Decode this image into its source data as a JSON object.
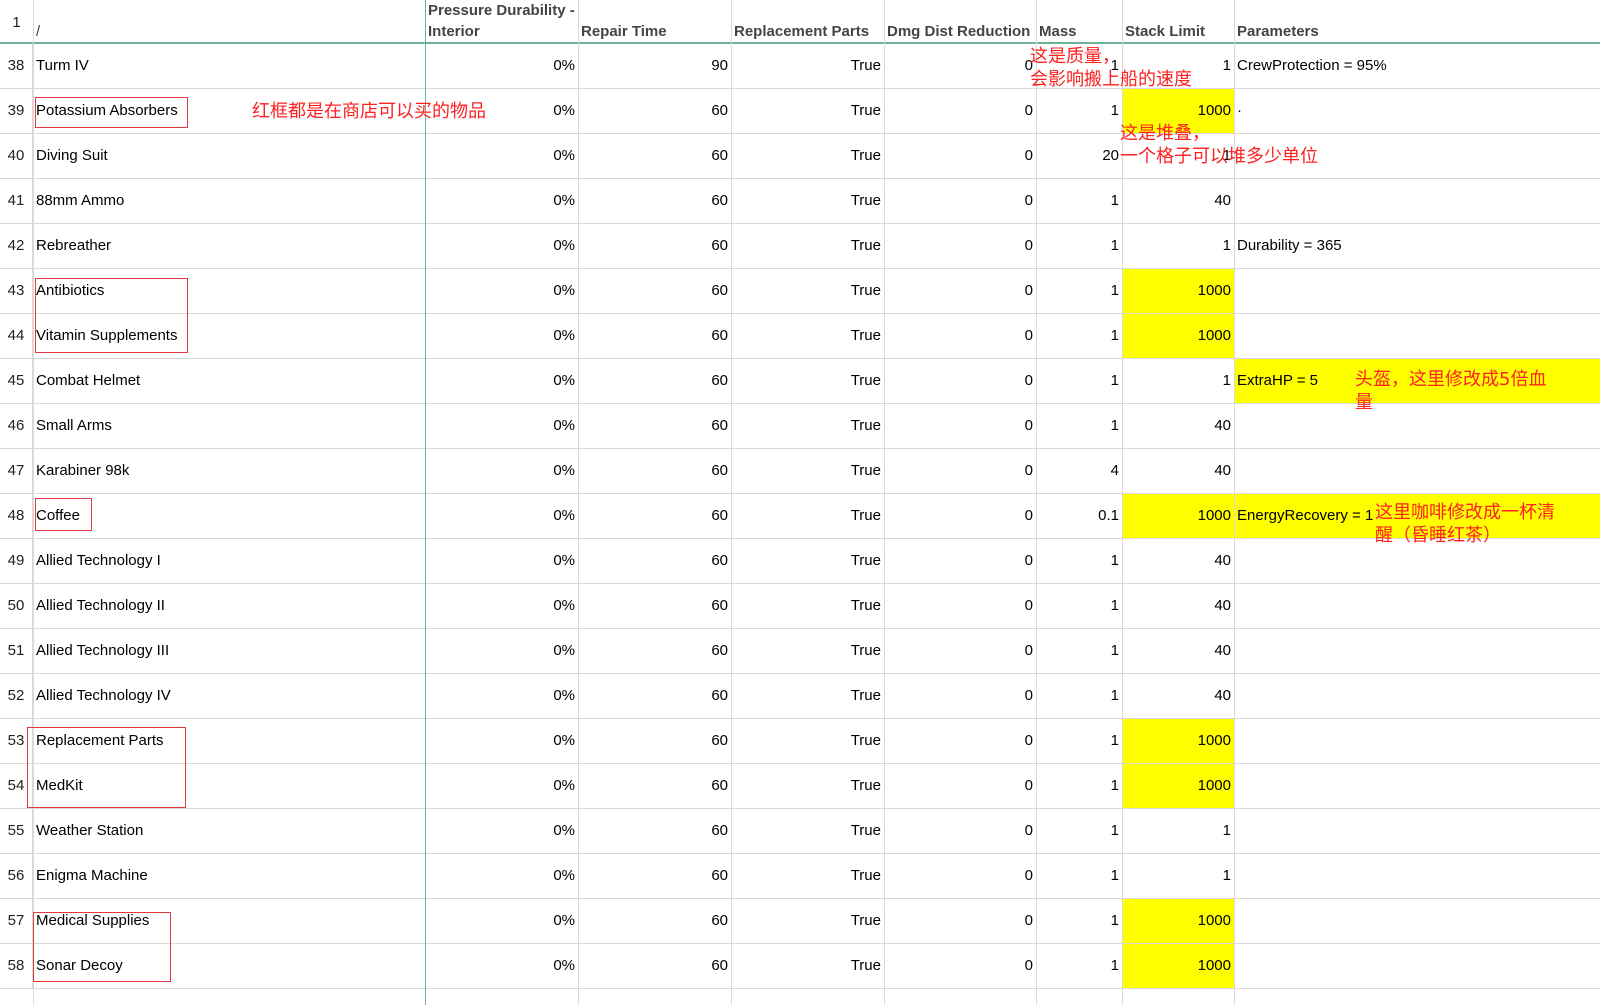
{
  "header": {
    "row_number": "1",
    "name": "/",
    "pressure_durability": "Pressure Durability -\nInterior",
    "pressure_durability_line1": "Pressure Durability -",
    "pressure_durability_line2": "Interior",
    "repair_time": "Repair Time",
    "replacement_parts": "Replacement Parts",
    "dmg_dist_reduction": "Dmg Dist Reduction",
    "mass": "Mass",
    "stack_limit": "Stack Limit",
    "parameters": "Parameters"
  },
  "rows": [
    {
      "num": "38",
      "name": "Turm IV",
      "pressure": "0%",
      "repair": "90",
      "parts": "True",
      "dmg": "0",
      "mass": "1",
      "stack": "1",
      "params": "CrewProtection = 95%",
      "stack_hl": false,
      "params_hl": false
    },
    {
      "num": "39",
      "name": "Potassium Absorbers",
      "pressure": "0%",
      "repair": "60",
      "parts": "True",
      "dmg": "0",
      "mass": "1",
      "stack": "1000",
      "params": "·",
      "stack_hl": true,
      "params_hl": false
    },
    {
      "num": "40",
      "name": "Diving Suit",
      "pressure": "0%",
      "repair": "60",
      "parts": "True",
      "dmg": "0",
      "mass": "20",
      "stack": "1",
      "params": "",
      "stack_hl": false,
      "params_hl": false
    },
    {
      "num": "41",
      "name": "88mm Ammo",
      "pressure": "0%",
      "repair": "60",
      "parts": "True",
      "dmg": "0",
      "mass": "1",
      "stack": "40",
      "params": "",
      "stack_hl": false,
      "params_hl": false
    },
    {
      "num": "42",
      "name": "Rebreather",
      "pressure": "0%",
      "repair": "60",
      "parts": "True",
      "dmg": "0",
      "mass": "1",
      "stack": "1",
      "params": "Durability = 365",
      "stack_hl": false,
      "params_hl": false
    },
    {
      "num": "43",
      "name": "Antibiotics",
      "pressure": "0%",
      "repair": "60",
      "parts": "True",
      "dmg": "0",
      "mass": "1",
      "stack": "1000",
      "params": "",
      "stack_hl": true,
      "params_hl": false
    },
    {
      "num": "44",
      "name": "Vitamin Supplements",
      "pressure": "0%",
      "repair": "60",
      "parts": "True",
      "dmg": "0",
      "mass": "1",
      "stack": "1000",
      "params": "",
      "stack_hl": true,
      "params_hl": false
    },
    {
      "num": "45",
      "name": "Combat Helmet",
      "pressure": "0%",
      "repair": "60",
      "parts": "True",
      "dmg": "0",
      "mass": "1",
      "stack": "1",
      "params": "ExtraHP = 5",
      "stack_hl": false,
      "params_hl": true
    },
    {
      "num": "46",
      "name": "Small Arms",
      "pressure": "0%",
      "repair": "60",
      "parts": "True",
      "dmg": "0",
      "mass": "1",
      "stack": "40",
      "params": "",
      "stack_hl": false,
      "params_hl": false
    },
    {
      "num": "47",
      "name": "Karabiner 98k",
      "pressure": "0%",
      "repair": "60",
      "parts": "True",
      "dmg": "0",
      "mass": "4",
      "stack": "40",
      "params": "",
      "stack_hl": false,
      "params_hl": false
    },
    {
      "num": "48",
      "name": "Coffee",
      "pressure": "0%",
      "repair": "60",
      "parts": "True",
      "dmg": "0",
      "mass": "0.1",
      "stack": "1000",
      "params": "EnergyRecovery = 1",
      "stack_hl": true,
      "params_hl": true
    },
    {
      "num": "49",
      "name": "Allied Technology I",
      "pressure": "0%",
      "repair": "60",
      "parts": "True",
      "dmg": "0",
      "mass": "1",
      "stack": "40",
      "params": "",
      "stack_hl": false,
      "params_hl": false
    },
    {
      "num": "50",
      "name": "Allied Technology II",
      "pressure": "0%",
      "repair": "60",
      "parts": "True",
      "dmg": "0",
      "mass": "1",
      "stack": "40",
      "params": "",
      "stack_hl": false,
      "params_hl": false
    },
    {
      "num": "51",
      "name": "Allied Technology III",
      "pressure": "0%",
      "repair": "60",
      "parts": "True",
      "dmg": "0",
      "mass": "1",
      "stack": "40",
      "params": "",
      "stack_hl": false,
      "params_hl": false
    },
    {
      "num": "52",
      "name": "Allied Technology IV",
      "pressure": "0%",
      "repair": "60",
      "parts": "True",
      "dmg": "0",
      "mass": "1",
      "stack": "40",
      "params": "",
      "stack_hl": false,
      "params_hl": false
    },
    {
      "num": "53",
      "name": "Replacement Parts",
      "pressure": "0%",
      "repair": "60",
      "parts": "True",
      "dmg": "0",
      "mass": "1",
      "stack": "1000",
      "params": "",
      "stack_hl": true,
      "params_hl": false
    },
    {
      "num": "54",
      "name": "MedKit",
      "pressure": "0%",
      "repair": "60",
      "parts": "True",
      "dmg": "0",
      "mass": "1",
      "stack": "1000",
      "params": "",
      "stack_hl": true,
      "params_hl": false
    },
    {
      "num": "55",
      "name": "Weather Station",
      "pressure": "0%",
      "repair": "60",
      "parts": "True",
      "dmg": "0",
      "mass": "1",
      "stack": "1",
      "params": "",
      "stack_hl": false,
      "params_hl": false
    },
    {
      "num": "56",
      "name": "Enigma Machine",
      "pressure": "0%",
      "repair": "60",
      "parts": "True",
      "dmg": "0",
      "mass": "1",
      "stack": "1",
      "params": "",
      "stack_hl": false,
      "params_hl": false
    },
    {
      "num": "57",
      "name": "Medical Supplies",
      "pressure": "0%",
      "repair": "60",
      "parts": "True",
      "dmg": "0",
      "mass": "1",
      "stack": "1000",
      "params": "",
      "stack_hl": true,
      "params_hl": false
    },
    {
      "num": "58",
      "name": "Sonar Decoy",
      "pressure": "0%",
      "repair": "60",
      "parts": "True",
      "dmg": "0",
      "mass": "1",
      "stack": "1000",
      "params": "",
      "stack_hl": true,
      "params_hl": false
    }
  ],
  "annotations": {
    "shop_note": "红框都是在商店可以买的物品",
    "mass_note_line1": "这是质量，",
    "mass_note_line2": "会影响搬上船的速度",
    "stack_note_line1": "这是堆叠，",
    "stack_note_line2": "一个格子可以堆多少单位",
    "helmet_note_line1": "头盔，这里修改成5倍血",
    "helmet_note_line2": "量",
    "coffee_note_line1": "这里咖啡修改成一杯清",
    "coffee_note_line2": "醒（昏睡红茶）"
  },
  "colors": {
    "highlight": "#ffff00",
    "annotation": "#ff2020",
    "red_box": "#e0393e",
    "freeze_line": "#6fb394"
  }
}
